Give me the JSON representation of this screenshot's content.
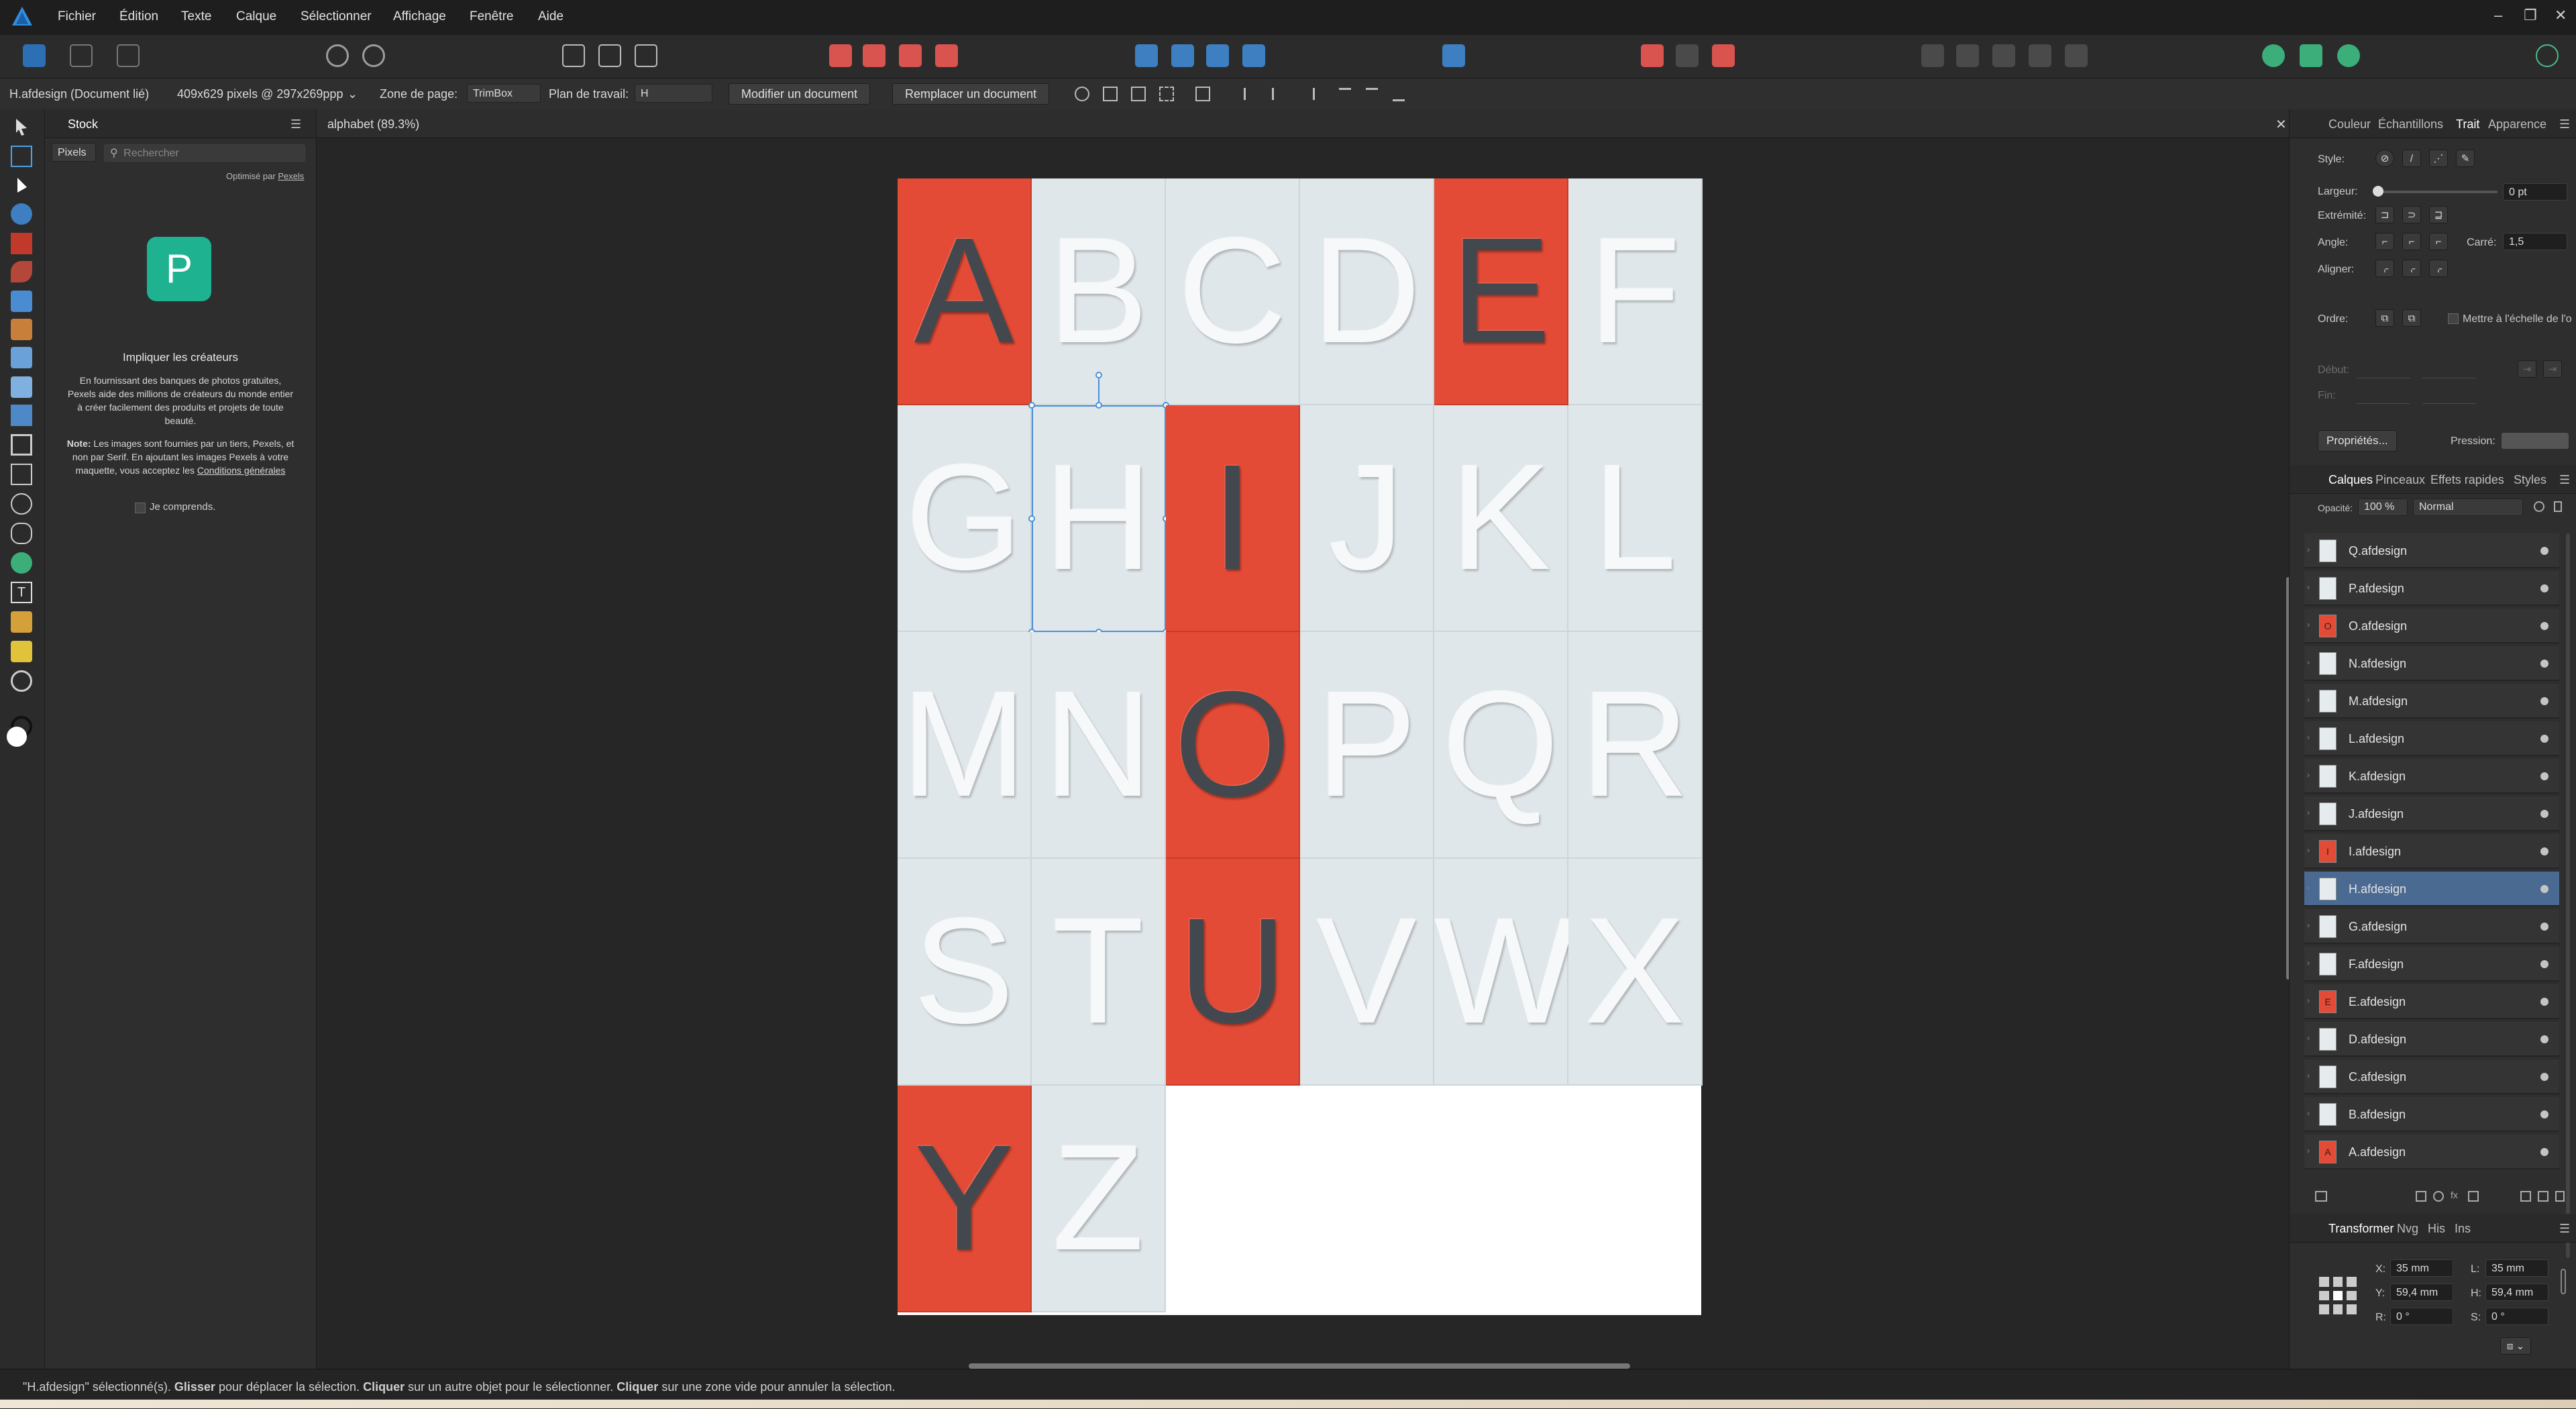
{
  "menu": [
    "Fichier",
    "Édition",
    "Texte",
    "Calque",
    "Sélectionner",
    "Affichage",
    "Fenêtre",
    "Aide"
  ],
  "context": {
    "doc_label": "H.afdesign (Document lié)",
    "doc_size": "409x629 pixels @ 297x269ppp",
    "zone_label": "Zone de page:",
    "zone_value": "TrimBox",
    "plan_label": "Plan de travail:",
    "plan_value": "H",
    "modify_btn": "Modifier un document",
    "replace_btn": "Remplacer un document"
  },
  "stock": {
    "title": "Stock",
    "source": "Pixels",
    "search_placeholder": "Rechercher",
    "powered": "Optimisé par",
    "powered_link": "Pexels",
    "headline": "Impliquer les créateurs",
    "body": "En fournissant des banques de photos gratuites, Pexels aide des millions de créateurs du monde entier à créer facilement des produits et projets de toute beauté.",
    "note_bold": "Note:",
    "note": "Les images sont fournies par un tiers, Pexels, et non par Serif. En ajoutant les images Pexels à votre maquette, vous acceptez les",
    "note_link": "Conditions générales",
    "checkbox": "Je comprends."
  },
  "canvas_tab": "alphabet (89.3%)",
  "letters": {
    "rows": [
      [
        "A",
        "B",
        "C",
        "D",
        "E",
        "F"
      ],
      [
        "G",
        "H",
        "I",
        "J",
        "K",
        "L"
      ],
      [
        "M",
        "N",
        "O",
        "P",
        "Q",
        "R"
      ],
      [
        "S",
        "T",
        "U",
        "V",
        "W",
        "X"
      ],
      [
        "Y",
        "Z"
      ]
    ],
    "red": [
      "A",
      "E",
      "I",
      "O",
      "U",
      "Y"
    ],
    "selected": "H",
    "colors": {
      "red": "#e34b36",
      "light": "#e0e7ea"
    }
  },
  "stroke_panel": {
    "tabs": [
      "Couleur",
      "Échantillons",
      "Trait",
      "Apparence"
    ],
    "active": "Trait",
    "style": "Style:",
    "width_label": "Largeur:",
    "width_value": "0 pt",
    "cap": "Extrémité:",
    "join": "Angle:",
    "square_label": "Carré:",
    "square_value": "1,5",
    "align": "Aligner:",
    "order": "Ordre:",
    "scale": "Mettre à l'échelle de l'o",
    "start": "Début:",
    "end": "Fin:",
    "props_btn": "Propriétés...",
    "pressure": "Pression:"
  },
  "layers_panel": {
    "tabs": [
      "Calques",
      "Pinceaux",
      "Effets rapides",
      "Styles"
    ],
    "active": "Calques",
    "opacity_label": "Opacité:",
    "opacity_value": "100 %",
    "blend": "Normal",
    "layers": [
      {
        "name": "Q.afdesign",
        "letter": "",
        "red": false
      },
      {
        "name": "P.afdesign",
        "letter": "",
        "red": false
      },
      {
        "name": "O.afdesign",
        "letter": "O",
        "red": true
      },
      {
        "name": "N.afdesign",
        "letter": "",
        "red": false
      },
      {
        "name": "M.afdesign",
        "letter": "",
        "red": false
      },
      {
        "name": "L.afdesign",
        "letter": "",
        "red": false
      },
      {
        "name": "K.afdesign",
        "letter": "",
        "red": false
      },
      {
        "name": "J.afdesign",
        "letter": "",
        "red": false
      },
      {
        "name": "I.afdesign",
        "letter": "I",
        "red": true
      },
      {
        "name": "H.afdesign",
        "letter": "",
        "red": false,
        "selected": true
      },
      {
        "name": "G.afdesign",
        "letter": "",
        "red": false
      },
      {
        "name": "F.afdesign",
        "letter": "",
        "red": false
      },
      {
        "name": "E.afdesign",
        "letter": "E",
        "red": true
      },
      {
        "name": "D.afdesign",
        "letter": "",
        "red": false
      },
      {
        "name": "C.afdesign",
        "letter": "",
        "red": false
      },
      {
        "name": "B.afdesign",
        "letter": "",
        "red": false
      },
      {
        "name": "A.afdesign",
        "letter": "A",
        "red": true
      }
    ]
  },
  "transform_panel": {
    "tabs": [
      "Transformer",
      "Nvg",
      "His",
      "Ins"
    ],
    "active": "Transformer",
    "x_label": "X:",
    "x": "35 mm",
    "w_label": "L:",
    "w": "35 mm",
    "y_label": "Y:",
    "y": "59,4 mm",
    "h_label": "H:",
    "h": "59,4 mm",
    "r_label": "R:",
    "r": "0 °",
    "s_label": "S:",
    "s": "0 °"
  },
  "status": {
    "p1": "\"H.afdesign\" sélectionné(s). ",
    "b1": "Glisser",
    "p2": " pour déplacer la sélection. ",
    "b2": "Cliquer",
    "p3": " sur un autre objet pour le sélectionner. ",
    "b3": "Cliquer",
    "p4": " sur une zone vide pour annuler la sélection."
  }
}
